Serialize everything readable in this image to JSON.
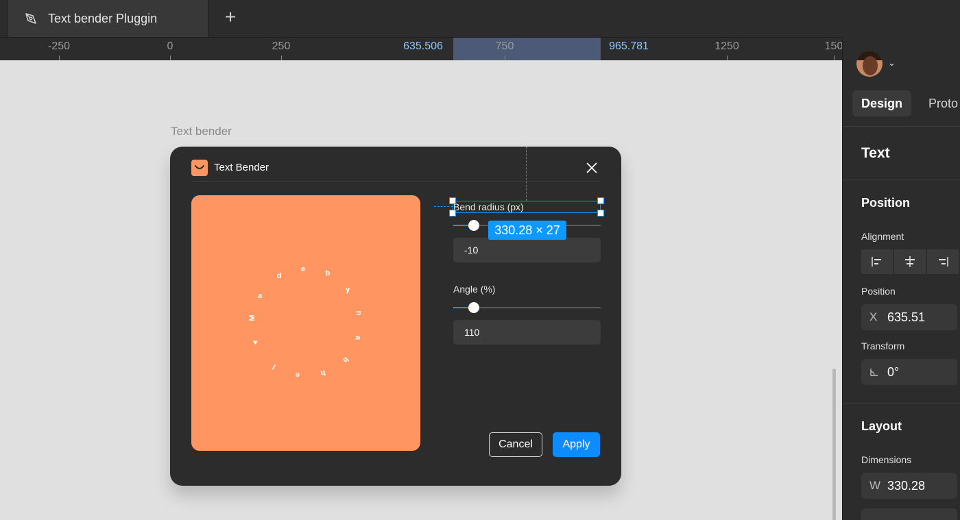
{
  "tab": {
    "title": "Text bender Pluggin",
    "icon": "pen-icon"
  },
  "new_tab_icon": "plus-icon",
  "ruler": {
    "labels": [
      "-250",
      "0",
      "250",
      "635.506",
      "750",
      "965.781",
      "1250",
      "150"
    ],
    "selection_start": "635.506",
    "selection_end": "965.781"
  },
  "canvas": {
    "frame_label": "Text bender"
  },
  "dialog": {
    "title": "Text Bender",
    "logo_icon": "smile-logo-icon",
    "close_icon": "close-icon",
    "preview_text_chars": [
      "M",
      "a",
      "d",
      "e",
      "b",
      "y",
      "n",
      "a",
      "b",
      "h",
      "e",
      "l",
      "♥"
    ],
    "bend_radius": {
      "label": "Bend radius (px)",
      "value": "-10",
      "slider_fraction": 0.14
    },
    "angle": {
      "label": "Angle (%)",
      "value": "110",
      "slider_fraction": 0.14
    },
    "cancel_label": "Cancel",
    "apply_label": "Apply"
  },
  "selection": {
    "dimensions": "330.28 × 27"
  },
  "panel": {
    "tabs": {
      "design": "Design",
      "prototype": "Proto"
    },
    "section_text": "Text",
    "section_position": "Position",
    "alignment_label": "Alignment",
    "alignment_icons": [
      "align-left-icon",
      "align-center-icon",
      "align-right-icon"
    ],
    "position_label": "Position",
    "position_x_prefix": "X",
    "position_x": "635.51",
    "transform_label": "Transform",
    "rotation": "0°",
    "rotation_icon": "angle-icon",
    "section_layout": "Layout",
    "dimensions_label": "Dimensions",
    "width_prefix": "W",
    "width": "330.28"
  },
  "colors": {
    "accent": "#0d99ff",
    "preview_bg": "#ff9560",
    "dialog_bg": "#2c2c2c"
  }
}
